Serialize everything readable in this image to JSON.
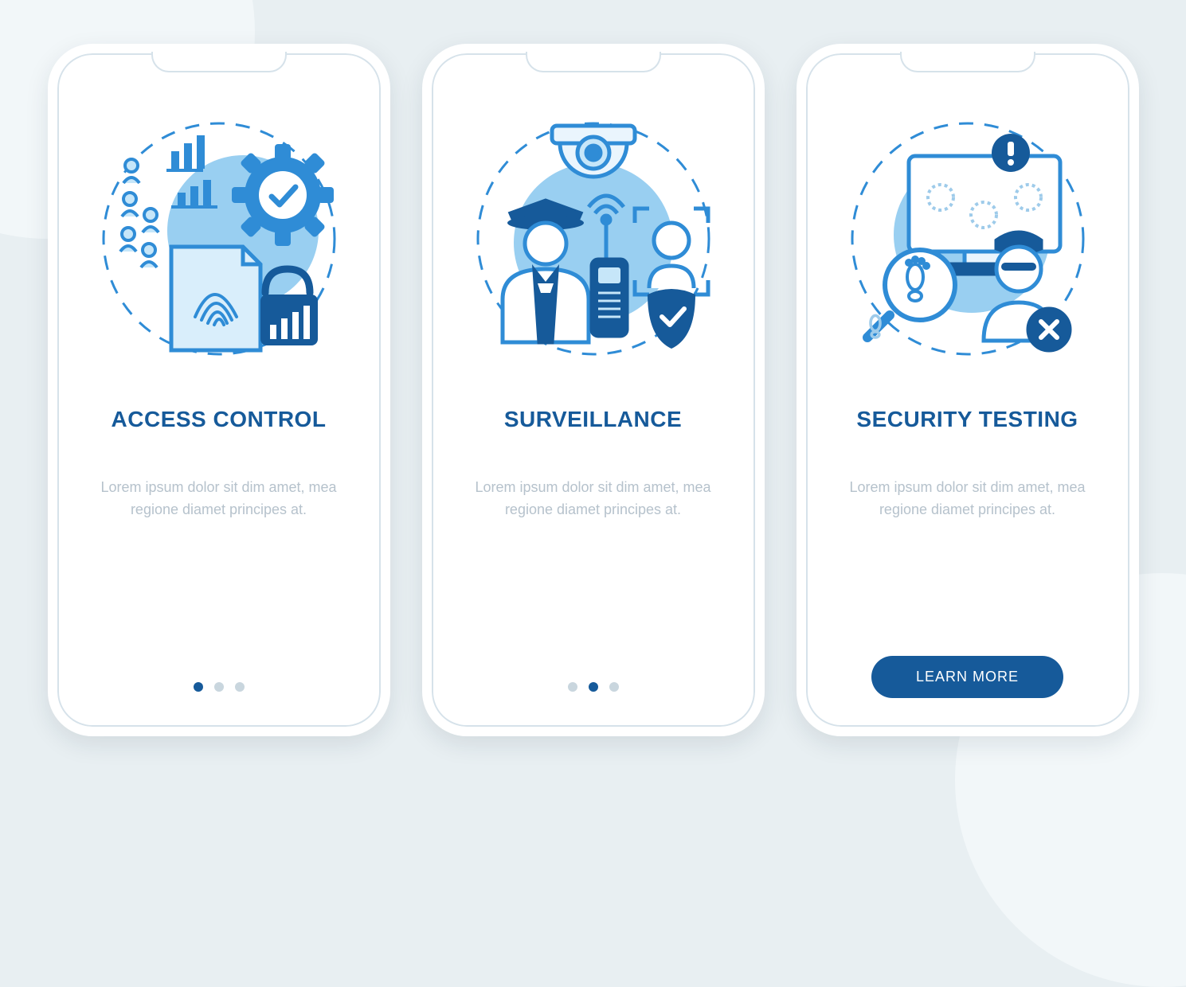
{
  "colors": {
    "primary": "#165a9a",
    "accent": "#2f8cd6",
    "fillLight": "#99cff1",
    "bg": "#e8eff2",
    "textMuted": "#b6c2cc"
  },
  "screens": [
    {
      "title": "ACCESS CONTROL",
      "description": "Lorem ipsum dolor sit dim amet, mea regione diamet principes at.",
      "indicator": {
        "count": 3,
        "active": 0
      },
      "cta": null,
      "illustration": "access-control-illustration",
      "illustration_elements": [
        "fingerprint-icon",
        "padlock-icon",
        "gear-check-icon",
        "people-bars-icon"
      ]
    },
    {
      "title": "SURVEILLANCE",
      "description": "Lorem ipsum dolor sit dim amet, mea regione diamet principes at.",
      "indicator": {
        "count": 3,
        "active": 1
      },
      "cta": null,
      "illustration": "surveillance-illustration",
      "illustration_elements": [
        "dome-camera-icon",
        "guard-icon",
        "radio-icon",
        "shield-check-icon",
        "face-scan-icon"
      ]
    },
    {
      "title": "SECURITY TESTING",
      "description": "Lorem ipsum dolor sit dim amet, mea regione diamet principes at.",
      "indicator": null,
      "cta": "LEARN MORE",
      "illustration": "security-testing-illustration",
      "illustration_elements": [
        "monitor-gears-icon",
        "alert-icon",
        "magnifier-footprint-icon",
        "intruder-x-icon"
      ]
    }
  ]
}
